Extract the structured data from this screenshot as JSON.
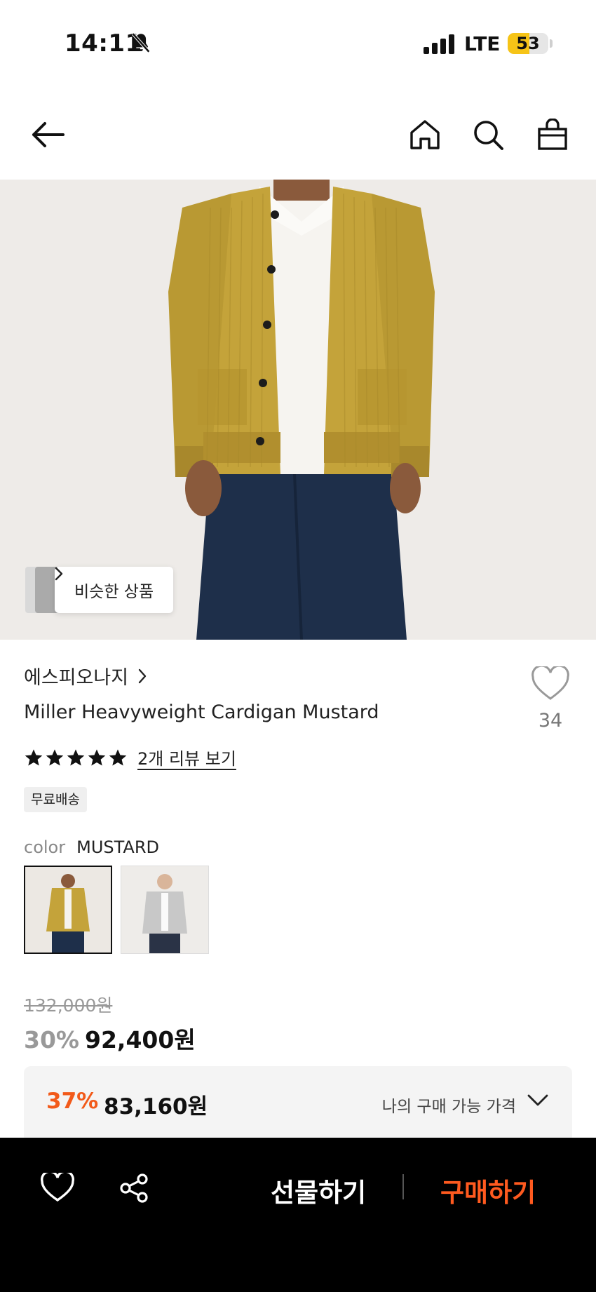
{
  "status": {
    "time": "14:11",
    "network": "LTE",
    "battery": "53",
    "battery_level": 0.53
  },
  "nav": {
    "icons": [
      "back-arrow-icon",
      "home-icon",
      "search-icon",
      "shopping-bag-icon"
    ]
  },
  "hero": {
    "similar_label": "비슷한 상품"
  },
  "product": {
    "brand": "에스피오나지",
    "title": "Miller Heavyweight Cardigan Mustard",
    "like_count": "34",
    "rating_stars": 5,
    "review_link": "2개 리뷰 보기",
    "shipping_badge": "무료배송",
    "color_label": "color",
    "color_value": "MUSTARD",
    "swatches": [
      "mustard",
      "grey"
    ],
    "original_price": "132,000원",
    "discount_rate": "30%",
    "sale_price": "92,400원"
  },
  "my_price": {
    "discount_rate": "37%",
    "price": "83,160원",
    "label": "나의 구매 가능 가격"
  },
  "bottom_bar": {
    "gift_label": "선물하기",
    "buy_label": "구매하기"
  },
  "colors": {
    "accent_orange": "#f25a1a",
    "buy_orange": "#ff5a1f",
    "mustard": "#c9a93a",
    "battery_yellow": "#f6c417"
  }
}
